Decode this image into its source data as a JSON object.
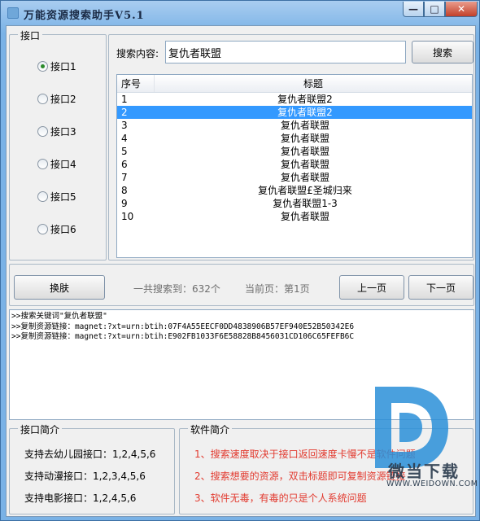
{
  "window": {
    "title": "万能资源搜索助手V5.1",
    "min": "—",
    "max": "□",
    "close": "✕"
  },
  "interface_group": {
    "label": "接口",
    "options": [
      "接口1",
      "接口2",
      "接口3",
      "接口4",
      "接口5",
      "接口6"
    ],
    "selected_index": 0
  },
  "search": {
    "label": "搜索内容:",
    "value": "复仇者联盟",
    "button": "搜索"
  },
  "results": {
    "headers": {
      "no": "序号",
      "title": "标题"
    },
    "rows": [
      {
        "no": "1",
        "title": "复仇者联盟2"
      },
      {
        "no": "2",
        "title": "复仇者联盟2"
      },
      {
        "no": "3",
        "title": "复仇者联盟"
      },
      {
        "no": "4",
        "title": "复仇者联盟"
      },
      {
        "no": "5",
        "title": "复仇者联盟"
      },
      {
        "no": "6",
        "title": "复仇者联盟"
      },
      {
        "no": "7",
        "title": "复仇者联盟"
      },
      {
        "no": "8",
        "title": "复仇者联盟£圣城归来"
      },
      {
        "no": "9",
        "title": "复仇者联盟1-3"
      },
      {
        "no": "10",
        "title": "复仇者联盟"
      }
    ],
    "selected_row": 1
  },
  "paging": {
    "skin_button": "换肤",
    "total": "一共搜索到：632个",
    "current": "当前页：第1页",
    "prev": "上一页",
    "next": "下一页"
  },
  "log": [
    ">>搜索关键词\"复仇者联盟\"",
    ">>复制资源链接：magnet:?xt=urn:btih:07F4A55EECF0DD4838906B57EF940E52B50342E6",
    ">>复制资源链接：magnet:?xt=urn:btih:E902FB1033F6E58828B8456031CD106C65FEFB6C"
  ],
  "api_intro": {
    "label": "接口简介",
    "lines": [
      "支持去幼儿园接口：1,2,4,5,6",
      "支持动漫接口：1,2,3,4,5,6",
      "支持电影接口：1,2,4,5,6"
    ]
  },
  "soft_intro": {
    "label": "软件简介",
    "lines": [
      "1、搜索速度取决于接口返回速度卡慢不是软件问题",
      "2、搜索想要的资源，双击标题即可复制资源链接",
      "3、软件无毒，有毒的只是个人系统问题"
    ],
    "color": "#e23a2f"
  },
  "watermark": {
    "text": "微当下载",
    "url": "WWW.WEIDOWN.COM",
    "color": "#2a8fd8"
  }
}
